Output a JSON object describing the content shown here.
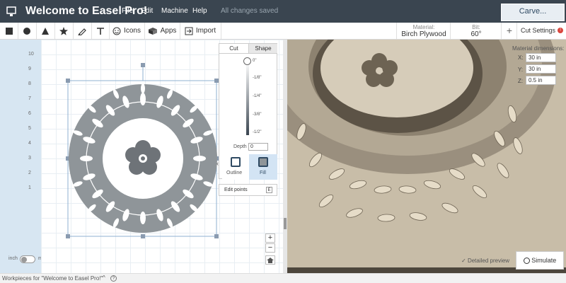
{
  "app": {
    "title": "Welcome to Easel Pro!",
    "menu": [
      "File",
      "Edit",
      "Machine",
      "Help"
    ],
    "status": "All changes saved",
    "carve_label": "Carve..."
  },
  "toolbar": {
    "tools": [
      {
        "name": "square-tool",
        "icon": "square-icon"
      },
      {
        "name": "circle-tool",
        "icon": "circle-icon"
      },
      {
        "name": "triangle-tool",
        "icon": "triangle-icon"
      },
      {
        "name": "star-tool",
        "icon": "star-icon"
      },
      {
        "name": "pen-tool",
        "icon": "pen-icon"
      },
      {
        "name": "text-tool",
        "icon": "text-icon"
      }
    ],
    "icons_label": "Icons",
    "apps_label": "Apps",
    "import_label": "Import",
    "material_key": "Material:",
    "material_value": "Birch Plywood",
    "bit_key": "Bit:",
    "bit_value": "60°",
    "add_label": "+",
    "cut_settings_label": "Cut Settings"
  },
  "ruler": {
    "ticks": [
      "10",
      "9",
      "8",
      "7",
      "6",
      "5",
      "4",
      "3",
      "2",
      "1"
    ]
  },
  "panel": {
    "tabs": [
      "Cut",
      "Shape"
    ],
    "depth_marks": [
      "0\"",
      "-1/8\"",
      "-1/4\"",
      "-3/8\"",
      "-1/2\""
    ],
    "depth_label": "Depth",
    "depth_value": "0",
    "outline_label": "Outline",
    "fill_label": "Fill",
    "edit_points_label": "Edit points",
    "edit_points_key": "E"
  },
  "canvas": {
    "zoom_in": "+",
    "zoom_out": "−",
    "units_left": "inch",
    "units_right": "mm"
  },
  "preview": {
    "dims_title": "Material dimensions:",
    "dims": [
      {
        "axis": "X:",
        "value": "30 in"
      },
      {
        "axis": "Y:",
        "value": "30 in"
      },
      {
        "axis": "Z:",
        "value": "0.5 in"
      }
    ],
    "detailed_label": "Detailed preview",
    "simulate_label": "Simulate"
  },
  "footer": {
    "text": "Workpieces for \"Welcome to Easel Pro!\""
  },
  "colors": {
    "topbar": "#3a4550",
    "accent": "#2f4a63",
    "shape": "#8f9599",
    "wood": "#c8bda8"
  }
}
